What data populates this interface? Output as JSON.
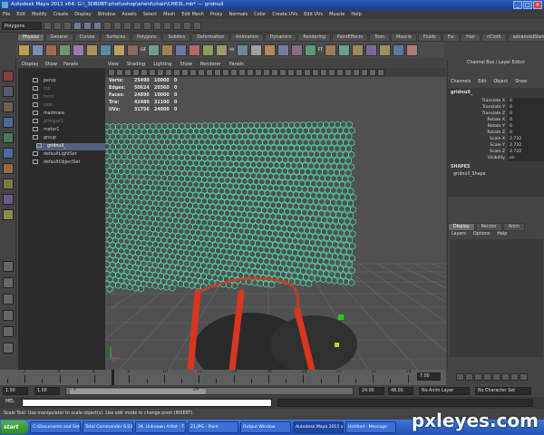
{
  "window": {
    "title": "Autodesk Maya 2011 x64: G:\\_3DB0BT-phot\\sshop\\ahenl\\chair\\CH63L.mb*   ---   gridnull"
  },
  "menubar": [
    "File",
    "Edit",
    "Modify",
    "Create",
    "Display",
    "Window",
    "Assets",
    "Select",
    "Mesh",
    "Edit Mesh",
    "Proxy",
    "Normals",
    "Color",
    "Create UVs",
    "Edit UVs",
    "Muscle",
    "Help"
  ],
  "statusline": {
    "mode": "Polygons"
  },
  "shelf_tabs": [
    "Physics",
    "General",
    "Curves",
    "Surfaces",
    "Polygons",
    "Subdivs",
    "Deformation",
    "Animation",
    "Dynamics",
    "Rendering",
    "PaintEffects",
    "Toon",
    "Muscle",
    "Fluids",
    "Fur",
    "Hair",
    "nCloth",
    "advancedSkeleton"
  ],
  "shelf_active_tab": "Physics",
  "shelf_labels": [
    "GF",
    "Hr",
    "FT"
  ],
  "outliner": {
    "menu": [
      "Display",
      "Show",
      "Panels"
    ],
    "items": [
      {
        "label": "persp",
        "dim": false,
        "sel": false
      },
      {
        "label": "top",
        "dim": true,
        "sel": false
      },
      {
        "label": "front",
        "dim": true,
        "sel": false
      },
      {
        "label": "side",
        "dim": true,
        "sel": false
      },
      {
        "label": "madmare",
        "dim": false,
        "sel": false
      },
      {
        "label": "pHelper1",
        "dim": true,
        "sel": false
      },
      {
        "label": "motor1",
        "dim": false,
        "sel": false
      },
      {
        "label": "group",
        "dim": false,
        "sel": false
      },
      {
        "label": "gridnull_",
        "dim": false,
        "sel": true
      },
      {
        "label": "defaultLightSet",
        "dim": false,
        "sel": false
      },
      {
        "label": "defaultObjectSet",
        "dim": false,
        "sel": false
      }
    ]
  },
  "viewport": {
    "menu": [
      "View",
      "Shading",
      "Lighting",
      "Show",
      "Renderer",
      "Panels"
    ],
    "hud": [
      {
        "label": "Verts:",
        "a": "25490",
        "b": "10000",
        "c": "0"
      },
      {
        "label": "Edges:",
        "a": "50624",
        "b": "20360",
        "c": "0"
      },
      {
        "label": "Faces:",
        "a": "24890",
        "b": "10000",
        "c": "0"
      },
      {
        "label": "Tris:",
        "a": "42480",
        "b": "31100",
        "c": "0"
      },
      {
        "label": "UVs:",
        "a": "31756",
        "b": "24000",
        "c": "0"
      }
    ],
    "mesh_color": "#48e0b0",
    "chair_color": "#d8361e"
  },
  "channelbox": {
    "title": "Channel Box / Layer Editor",
    "menu": [
      "Channels",
      "Edit",
      "Object",
      "Show"
    ],
    "object": "gridnull_",
    "channels": [
      {
        "label": "Translate X",
        "value": "0"
      },
      {
        "label": "Translate Y",
        "value": "0"
      },
      {
        "label": "Translate Z",
        "value": "0"
      },
      {
        "label": "Rotate X",
        "value": "0"
      },
      {
        "label": "Rotate Y",
        "value": "0"
      },
      {
        "label": "Rotate Z",
        "value": "0"
      },
      {
        "label": "Scale X",
        "value": "2.732"
      },
      {
        "label": "Scale Y",
        "value": "2.732"
      },
      {
        "label": "Scale Z",
        "value": "2.732"
      },
      {
        "label": "Visibility",
        "value": "on"
      }
    ],
    "shapes_header": "SHAPES",
    "shape": "gridnull_Shape",
    "layer_tabs": [
      "Display",
      "Render",
      "Anim"
    ],
    "layer_menu": [
      "Layers",
      "Options",
      "Help"
    ]
  },
  "timeline": {
    "ticks": [
      "2",
      "4",
      "6",
      "8",
      "10",
      "12",
      "14",
      "16",
      "18",
      "20",
      "22",
      "24"
    ],
    "current": "7.00"
  },
  "range": {
    "start": "1.00",
    "start2": "1.00",
    "slider_left": "1",
    "slider_right": "24",
    "end": "24.00",
    "end2": "48.00",
    "anim_layer": "No Anim Layer",
    "char_set": "No Character Set"
  },
  "cmdline": {
    "label": "MEL"
  },
  "helpline": {
    "text": "Scale Tool: Use manipulator to scale object(s). Use edit mode to change pivot (INSERT)."
  },
  "taskbar": {
    "start": "start",
    "tasks": [
      {
        "label": "C:\\Documents and Set...",
        "active": false
      },
      {
        "label": "Total Commander 6.03...",
        "active": false
      },
      {
        "label": "34. Unknown Artist - T...",
        "active": false
      },
      {
        "label": "21.JPG - Paint",
        "active": false
      },
      {
        "label": "Output Window",
        "active": false
      },
      {
        "label": "Autodesk Maya 2011 x...",
        "active": true
      },
      {
        "label": "Untitled - Message",
        "active": false
      }
    ]
  },
  "watermark": "pxleyes.com"
}
